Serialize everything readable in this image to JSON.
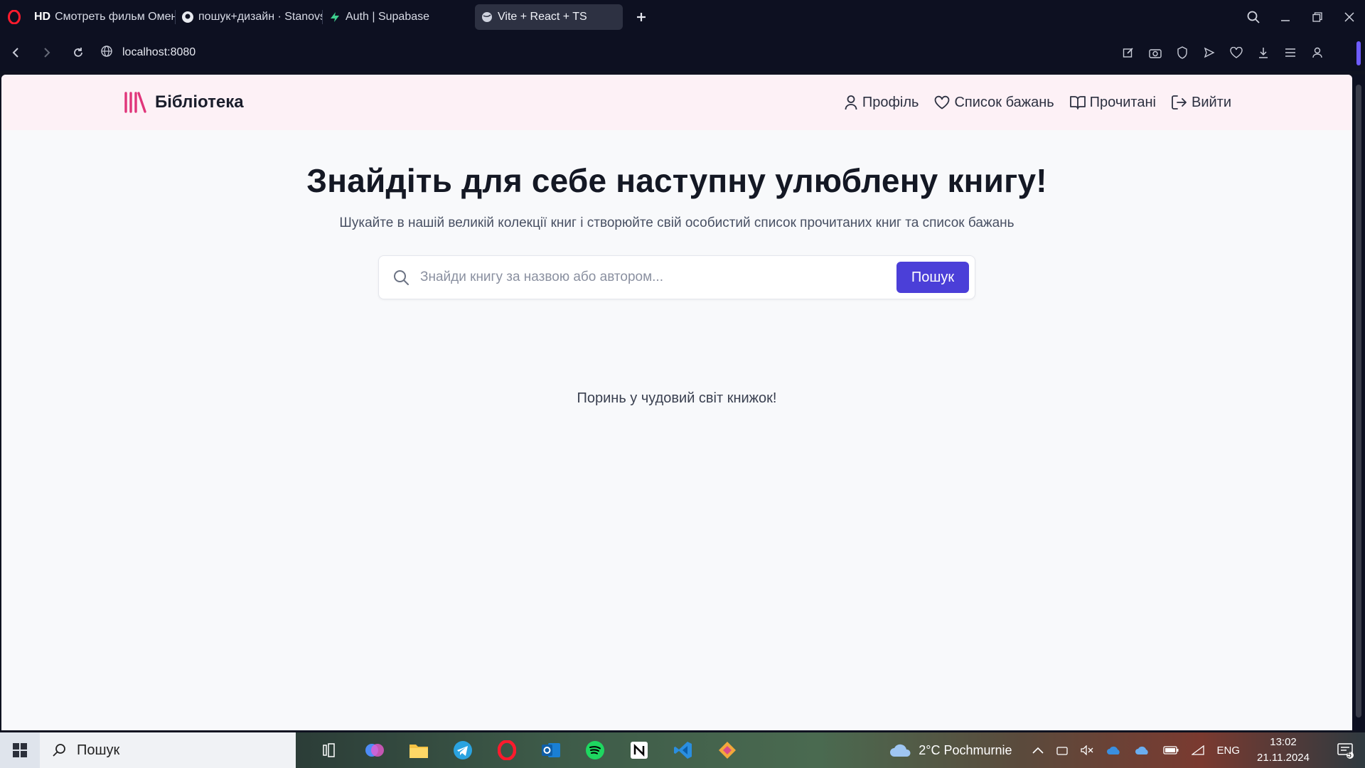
{
  "browser": {
    "tabs": [
      {
        "label": "Смотреть фильм Омен о",
        "prefix": "HD"
      },
      {
        "label": "пошук+дизайн · Stanovsk"
      },
      {
        "label": "Auth | Supabase"
      },
      {
        "label": "Vite + React + TS"
      }
    ],
    "url": "localhost:8080"
  },
  "header": {
    "brand": "Бібліотека",
    "nav": [
      {
        "label": "Профіль",
        "icon": "user-icon"
      },
      {
        "label": "Список бажань",
        "icon": "heart-icon"
      },
      {
        "label": "Прочитані",
        "icon": "book-open-icon"
      },
      {
        "label": "Вийти",
        "icon": "logout-icon"
      }
    ]
  },
  "hero": {
    "title": "Знайдіть для себе наступну улюблену книгу!",
    "subtitle": "Шукайте в нашій великій колекції книг і створюйте свій особистий список прочитаних книг та список бажань"
  },
  "search": {
    "placeholder": "Знайди книгу за назвою або автором...",
    "button": "Пошук"
  },
  "tagline": "Поринь у чудовий світ книжок!",
  "taskbar": {
    "search_label": "Пошук",
    "weather": "2°C  Pochmurnie",
    "lang": "ENG",
    "time": "13:02",
    "date": "21.11.2024",
    "notifications": "5"
  },
  "colors": {
    "accent": "#4b3fd8",
    "header_bg": "#fdf1f6",
    "logo": "#e0357a"
  }
}
